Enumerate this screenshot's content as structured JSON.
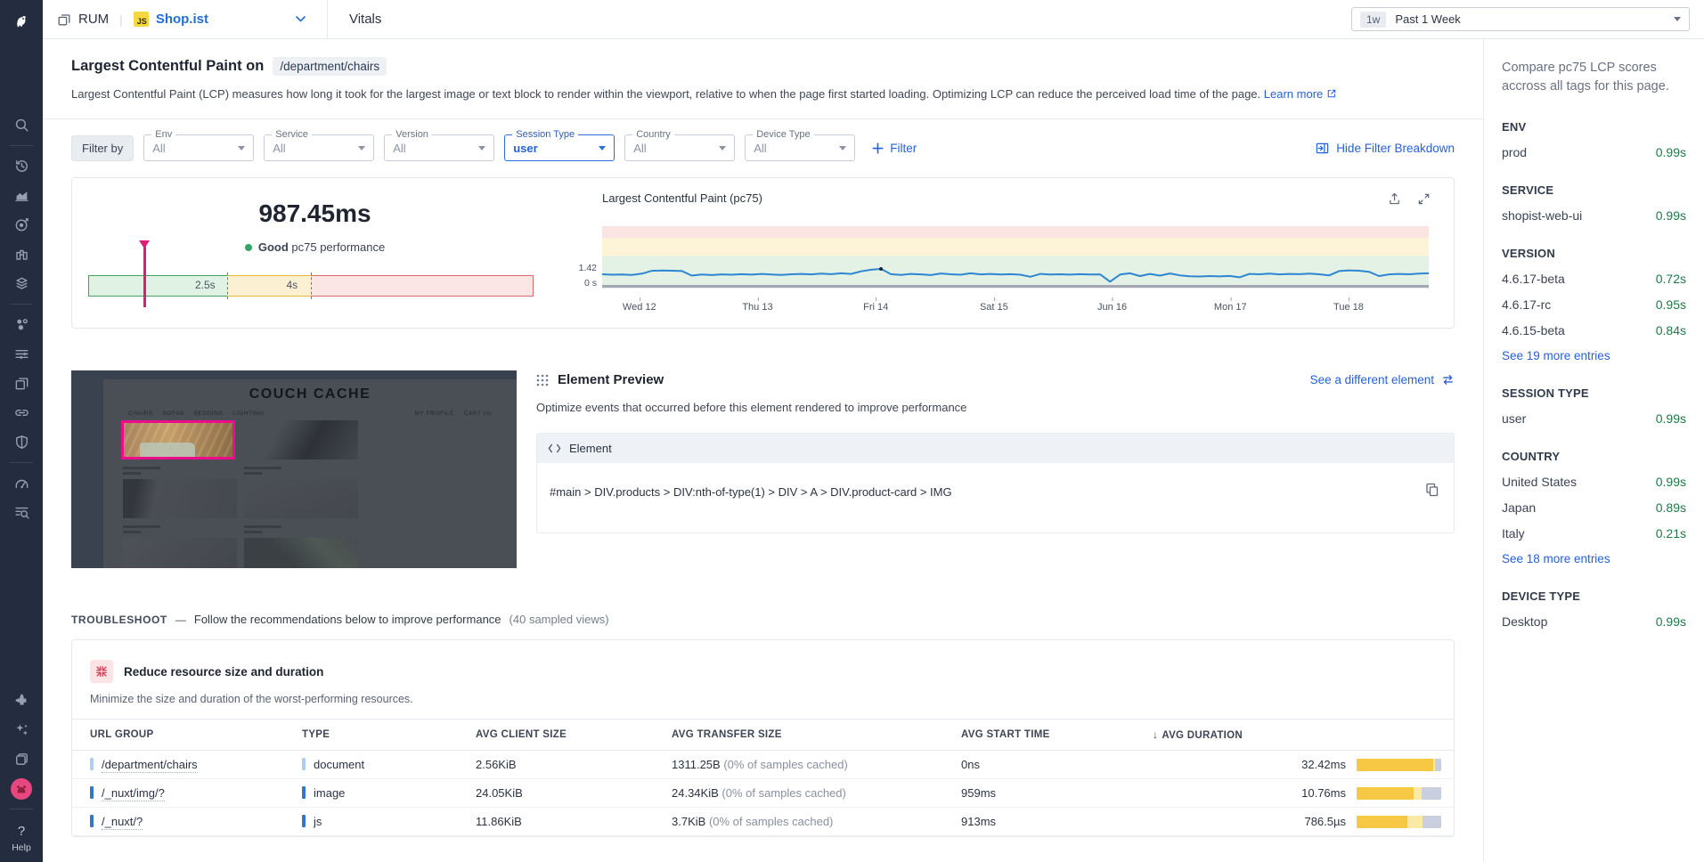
{
  "topbar": {
    "product": "RUM",
    "divider": "|",
    "app_badge": "JS",
    "app_name": "Shop.ist",
    "tab": "Vitals",
    "time_badge": "1w",
    "time_label": "Past 1 Week"
  },
  "page": {
    "title": "Largest Contentful Paint on",
    "path": "/department/chairs",
    "description": "Largest Contentful Paint (LCP) measures how long it took for the largest image or text block to render within the viewport, relative to when the page first started loading. Optimizing LCP can reduce the perceived load time of the page.",
    "learn_more": "Learn more"
  },
  "filters": {
    "filter_by": "Filter by",
    "add_filter": "Filter",
    "hide_breakdown": "Hide Filter Breakdown",
    "items": [
      {
        "label": "Env",
        "value": "All"
      },
      {
        "label": "Service",
        "value": "All"
      },
      {
        "label": "Version",
        "value": "All"
      },
      {
        "label": "Session Type",
        "value": "user"
      },
      {
        "label": "Country",
        "value": "All"
      },
      {
        "label": "Device Type",
        "value": "All"
      }
    ]
  },
  "score": {
    "value": "987.45ms",
    "status": "Good",
    "status_rest": "pc75 performance",
    "tick1": "2.5s",
    "tick2": "4s"
  },
  "chart": {
    "title": "Largest Contentful Paint (pc75)",
    "y_tick": "1.42",
    "y_zero": "0 s",
    "x_labels": [
      "Wed 12",
      "Thu 13",
      "Fri 14",
      "Sat 15",
      "Jun 16",
      "Mon 17",
      "Tue 18"
    ],
    "y_max_seconds": 5.0,
    "thresholds_seconds": {
      "good_under": 2.5,
      "poor_over": 4
    },
    "series_seconds": [
      0.97,
      0.93,
      0.95,
      0.92,
      1.02,
      1.26,
      1.28,
      1.27,
      1.25,
      0.86,
      0.95,
      0.9,
      0.96,
      0.93,
      0.98,
      0.94,
      1.0,
      0.95,
      0.92,
      0.97,
      1.0,
      0.96,
      1.02,
      0.98,
      1.05,
      1.0,
      1.22,
      1.35,
      1.42,
      0.98,
      0.92,
      1.0,
      0.96,
      0.9,
      1.04,
      0.97,
      0.93,
      1.05,
      0.96,
      1.0,
      0.95,
      0.98,
      0.93,
      0.76,
      1.0,
      0.95,
      0.97,
      0.94,
      0.98,
      0.95,
      0.96,
      0.35,
      0.95,
      1.05,
      0.82,
      1.0,
      0.86,
      1.04,
      0.88,
      0.8,
      0.78,
      0.82,
      0.79,
      0.83,
      0.72,
      1.0,
      0.97,
      1.02,
      0.96,
      1.0,
      0.98,
      1.03,
      0.97,
      0.88,
      1.24,
      1.3,
      1.27,
      1.18,
      0.82,
      0.96,
      1.0,
      0.97,
      1.02,
      1.05
    ]
  },
  "element_preview": {
    "heading": "Element Preview",
    "action": "See a different element",
    "subtitle": "Optimize events that occurred before this element rendered to improve performance",
    "box_label": "Element",
    "selector": "#main > DIV.products > DIV:nth-of-type(1) > DIV > A > DIV.product-card > IMG",
    "site": {
      "title": "COUCH CACHE",
      "nav": [
        "CHAIRS",
        "SOFAS",
        "BEDDING",
        "LIGHTING"
      ],
      "account": [
        "MY PROFILE",
        "CART (0)"
      ]
    }
  },
  "troubleshoot": {
    "label": "TROUBLESHOOT",
    "dash": "—",
    "text": "Follow the recommendations below to improve performance",
    "sampled": "(40 sampled views)",
    "card_title": "Reduce resource size and duration",
    "card_subtitle": "Minimize the size and duration of the worst-performing resources.",
    "table": {
      "columns": [
        "URL GROUP",
        "TYPE",
        "AVG CLIENT SIZE",
        "AVG TRANSFER SIZE",
        "AVG START TIME",
        "AVG DURATION"
      ],
      "sorted_by": "AVG DURATION",
      "rows": [
        {
          "url": "/department/chairs",
          "type": "document",
          "client_size": "2.56KiB",
          "transfer_size": "1311.25B",
          "transfer_note": "(0% of samples cached)",
          "start_time": "0ns",
          "duration": "32.42ms",
          "bar": [
            90,
            3,
            7
          ]
        },
        {
          "url": "/_nuxt/img/?",
          "type": "image",
          "client_size": "24.05KiB",
          "transfer_size": "24.34KiB",
          "transfer_note": "(0% of samples cached)",
          "start_time": "959ms",
          "duration": "10.76ms",
          "bar": [
            67,
            10,
            23
          ]
        },
        {
          "url": "/_nuxt/?",
          "type": "js",
          "client_size": "11.86KiB",
          "transfer_size": "3.7KiB",
          "transfer_note": "(0% of samples cached)",
          "start_time": "913ms",
          "duration": "786.5µs",
          "bar": [
            60,
            18,
            22
          ]
        }
      ]
    }
  },
  "compare": {
    "intro": "Compare pc75 LCP scores accross all tags for this page.",
    "sections": [
      {
        "title": "ENV",
        "rows": [
          {
            "name": "prod",
            "value": "0.99s"
          }
        ]
      },
      {
        "title": "SERVICE",
        "rows": [
          {
            "name": "shopist-web-ui",
            "value": "0.99s"
          }
        ]
      },
      {
        "title": "VERSION",
        "rows": [
          {
            "name": "4.6.17-beta",
            "value": "0.72s"
          },
          {
            "name": "4.6.17-rc",
            "value": "0.95s"
          },
          {
            "name": "4.6.15-beta",
            "value": "0.84s"
          }
        ],
        "more": "See 19 more entries"
      },
      {
        "title": "SESSION TYPE",
        "rows": [
          {
            "name": "user",
            "value": "0.99s"
          }
        ]
      },
      {
        "title": "COUNTRY",
        "rows": [
          {
            "name": "United States",
            "value": "0.99s"
          },
          {
            "name": "Japan",
            "value": "0.89s"
          },
          {
            "name": "Italy",
            "value": "0.21s"
          }
        ],
        "more": "See 18 more entries"
      },
      {
        "title": "DEVICE TYPE",
        "rows": [
          {
            "name": "Desktop",
            "value": "0.99s"
          }
        ]
      }
    ]
  },
  "help_label": "Help",
  "colors": {
    "accent_blue": "#2760d8",
    "good_green": "#2fa765",
    "value_green": "#1d7a46",
    "marker_magenta": "#df1b78",
    "sidebar_navy": "#232d3f",
    "band_red": "#fbe5e3",
    "band_yellow": "#fdf4d7",
    "band_green": "#e4f2e6",
    "line_blue": "#2e86d2",
    "bar_yellow": "#f7c844",
    "bar_light_yellow": "#fbe9a6",
    "bar_gray": "#c9cfdf"
  }
}
